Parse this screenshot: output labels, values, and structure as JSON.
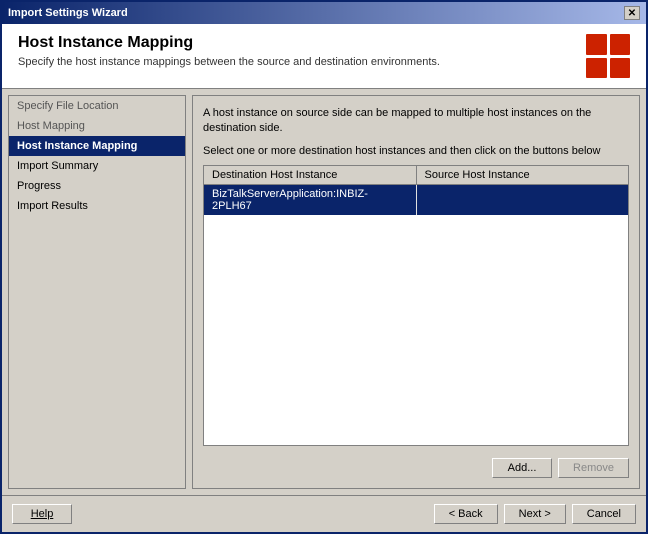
{
  "window": {
    "title": "Import Settings Wizard",
    "close_label": "✕"
  },
  "header": {
    "title": "Host Instance Mapping",
    "subtitle": "Specify the host instance mappings between the source and destination environments."
  },
  "sidebar": {
    "items": [
      {
        "id": "specify-file-location",
        "label": "Specify File Location",
        "state": "inactive"
      },
      {
        "id": "host-mapping",
        "label": "Host Mapping",
        "state": "inactive"
      },
      {
        "id": "host-instance-mapping",
        "label": "Host Instance Mapping",
        "state": "active"
      },
      {
        "id": "import-summary",
        "label": "Import Summary",
        "state": "normal"
      },
      {
        "id": "progress",
        "label": "Progress",
        "state": "normal"
      },
      {
        "id": "import-results",
        "label": "Import Results",
        "state": "normal"
      }
    ]
  },
  "main": {
    "description": "A host instance on source side can be mapped to multiple host instances on the destination side.",
    "instruction": "Select one or more destination host instances and then click on the buttons below",
    "table": {
      "columns": [
        {
          "id": "destination",
          "label": "Destination Host Instance"
        },
        {
          "id": "source",
          "label": "Source Host Instance"
        }
      ],
      "rows": [
        {
          "destination": "BizTalkServerApplication:INBIZ-2PLH67",
          "source": "",
          "selected": true
        }
      ]
    },
    "buttons": {
      "add_label": "Add...",
      "remove_label": "Remove"
    }
  },
  "footer": {
    "help_label": "Help",
    "back_label": "< Back",
    "next_label": "Next >",
    "cancel_label": "Cancel"
  }
}
